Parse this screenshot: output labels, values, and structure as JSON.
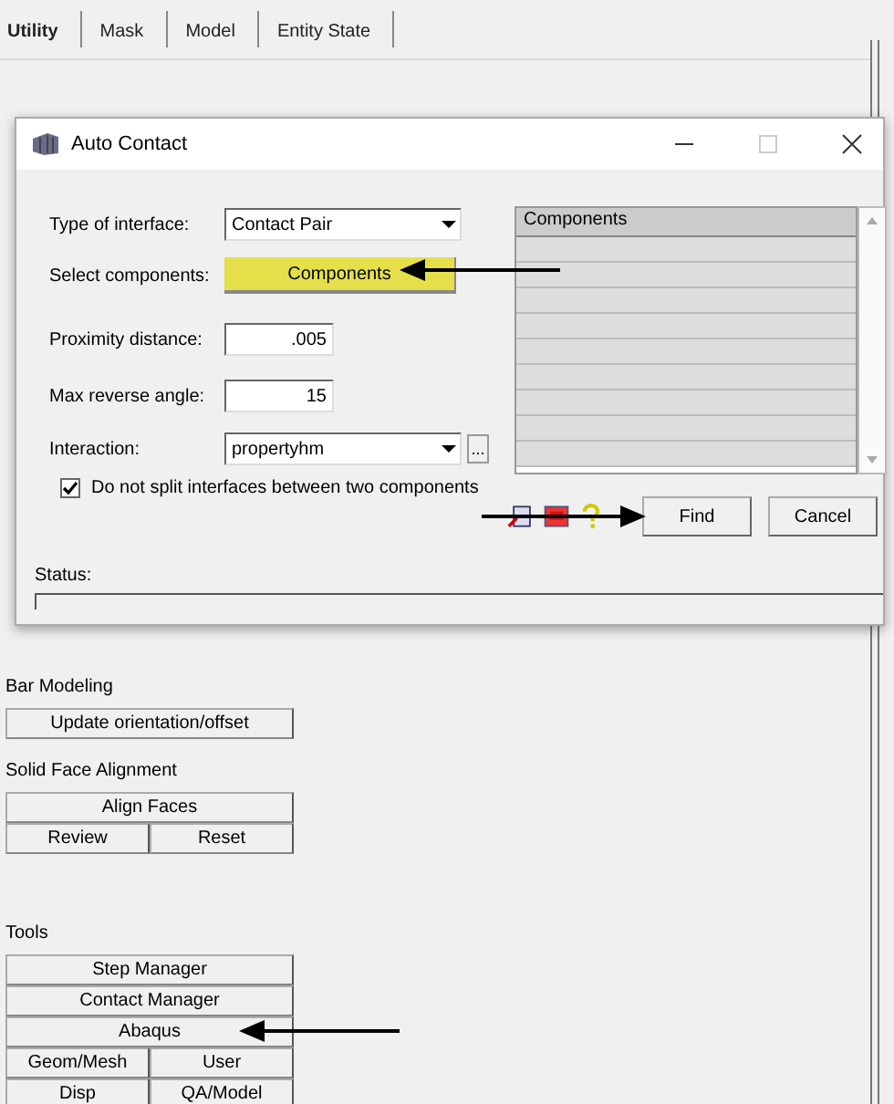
{
  "tabs": [
    {
      "label": "Utility",
      "selected": true
    },
    {
      "label": "Mask",
      "selected": false
    },
    {
      "label": "Model",
      "selected": false
    },
    {
      "label": "Entity State",
      "selected": false
    }
  ],
  "dialog": {
    "title": "Auto Contact",
    "type_of_interface": {
      "label": "Type of interface:",
      "value": "Contact Pair"
    },
    "select_components": {
      "label": "Select components:",
      "button": "Components"
    },
    "proximity_distance": {
      "label": "Proximity distance:",
      "value": ".005"
    },
    "max_reverse_angle": {
      "label": "Max reverse angle:",
      "value": "15"
    },
    "interaction": {
      "label": "Interaction:",
      "value": "propertyhm",
      "browse": "..."
    },
    "do_not_split": {
      "label": "Do not split interfaces between two components",
      "checked": true
    },
    "components_list": {
      "header": "Components"
    },
    "buttons": [
      "Find",
      "Cancel"
    ],
    "status": {
      "label": "Status:"
    }
  },
  "sections": [
    {
      "title": "Bar Modeling",
      "rows": [
        [
          "Update orientation/offset"
        ]
      ]
    },
    {
      "title": "Solid Face Alignment",
      "rows": [
        [
          "Align Faces"
        ],
        [
          "Review",
          "Reset"
        ]
      ]
    },
    {
      "title": "Tools",
      "rows": [
        [
          "Step Manager"
        ],
        [
          "Contact Manager"
        ],
        [
          "Abaqus"
        ],
        [
          "Geom/Mesh",
          "User"
        ],
        [
          "Disp",
          "QA/Model"
        ]
      ]
    }
  ]
}
